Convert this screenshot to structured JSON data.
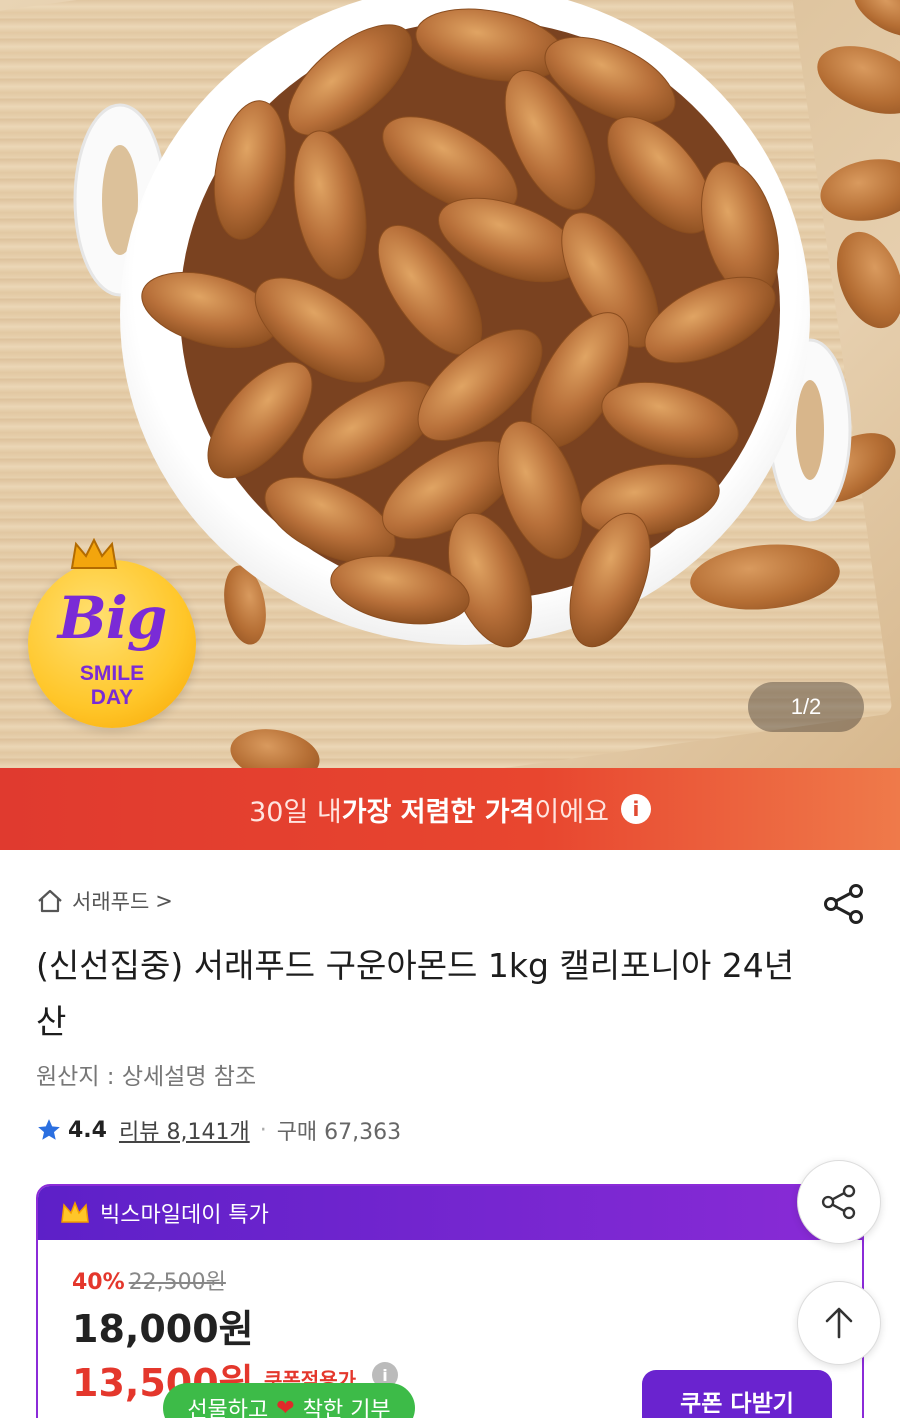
{
  "hero": {
    "badge": {
      "big": "Big",
      "smile": "SMILE",
      "day": "DAY"
    },
    "page_counter": "1/2"
  },
  "banner": {
    "part1": "30일 내 ",
    "part2": "가장 저렴한 가격",
    "part3": "이에요",
    "info": "i"
  },
  "breadcrumb": {
    "label": "서래푸드",
    "chevron": ">"
  },
  "product": {
    "title": "(신선집중) 서래푸드 구운아몬드 1kg 캘리포니아 24년산",
    "origin": "원산지 : 상세설명 참조",
    "rating": "4.4",
    "reviews": "리뷰 8,141개",
    "purchases": "구매 67,363"
  },
  "promo": {
    "header": "빅스마일데이 특가",
    "discount_pct": "40%",
    "original_price": "22,500원",
    "price": "18,000원",
    "coupon_price": "13,500원",
    "coupon_label": "쿠폰적용가",
    "coupon_info": "i",
    "coupon_button": "쿠폰 다받기"
  },
  "gift_pill": {
    "left": "선물하고",
    "right": "착한 기부"
  },
  "colors": {
    "banner_red": "#e03a2f",
    "promo_purple": "#7a2bd6",
    "price_red": "#e4372c",
    "gift_green": "#3dbb48",
    "star_blue": "#2b6fe0"
  }
}
